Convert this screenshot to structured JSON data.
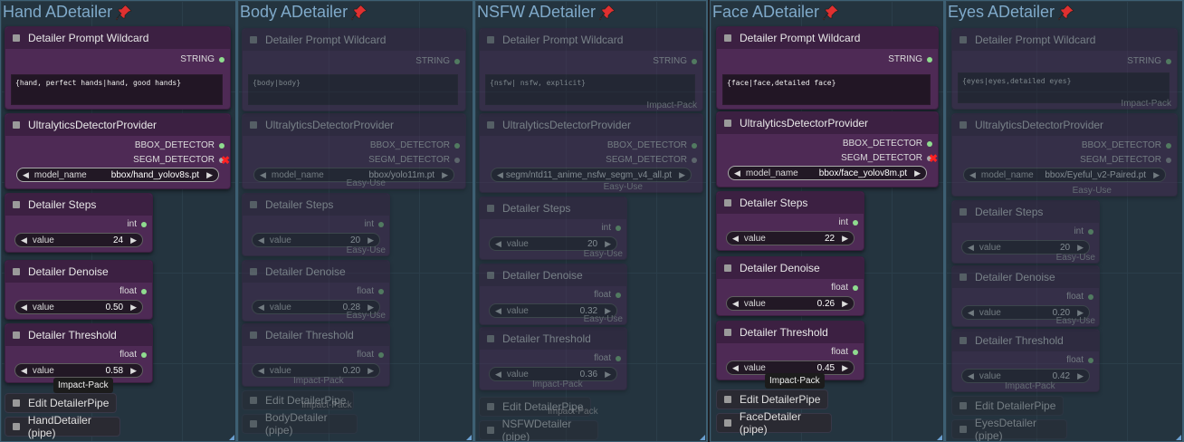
{
  "groups": [
    {
      "title": "Hand ADetailer",
      "active": true,
      "wildcard": {
        "title": "Detailer Prompt Wildcard",
        "output": "STRING",
        "text": "{hand, perfect hands|hand, good hands}"
      },
      "provider": {
        "title": "UltralyticsDetectorProvider",
        "out1": "BBOX_DETECTOR",
        "out2": "SEGM_DETECTOR",
        "model_label": "model_name",
        "model_value": "bbox/hand_yolov8s.pt"
      },
      "steps": {
        "title": "Detailer Steps",
        "type": "int",
        "label": "value",
        "value": "24"
      },
      "denoise": {
        "title": "Detailer Denoise",
        "type": "float",
        "label": "value",
        "value": "0.50"
      },
      "threshold": {
        "title": "Detailer Threshold",
        "type": "float",
        "label": "value",
        "value": "0.58"
      },
      "tooltip": "Impact-Pack",
      "edit_pipe": "Edit DetailerPipe",
      "pipe": "HandDetailer (pipe)"
    },
    {
      "title": "Body ADetailer",
      "active": false,
      "wildcard": {
        "title": "Detailer Prompt Wildcard",
        "output": "STRING",
        "text": "{body|body}"
      },
      "provider": {
        "title": "UltralyticsDetectorProvider",
        "out1": "BBOX_DETECTOR",
        "out2": "SEGM_DETECTOR",
        "model_label": "model_name",
        "model_value": "bbox/yolo11m.pt",
        "badge": "Easy-Use"
      },
      "steps": {
        "title": "Detailer Steps",
        "type": "int",
        "label": "value",
        "value": "20",
        "badge": "Easy-Use"
      },
      "denoise": {
        "title": "Detailer Denoise",
        "type": "float",
        "label": "value",
        "value": "0.28",
        "badge": "Easy-Use"
      },
      "threshold": {
        "title": "Detailer Threshold",
        "type": "float",
        "label": "value",
        "value": "0.20",
        "badge": "Impact-Pack"
      },
      "edit_pipe": "Edit DetailerPipe",
      "edit_badge": "Impact-Pack",
      "pipe": "BodyDetailer (pipe)"
    },
    {
      "title": "NSFW ADetailer",
      "active": false,
      "wildcard": {
        "title": "Detailer Prompt Wildcard",
        "output": "STRING",
        "text": "{nsfw| nsfw, explicit}",
        "badge": "Impact-Pack"
      },
      "provider": {
        "title": "UltralyticsDetectorProvider",
        "out1": "BBOX_DETECTOR",
        "out2": "SEGM_DETECTOR",
        "model_value": "segm/ntd11_anime_nsfw_segm_v4_all.pt",
        "badge": "Easy-Use"
      },
      "steps": {
        "title": "Detailer Steps",
        "type": "int",
        "label": "value",
        "value": "20",
        "badge": "Easy-Use"
      },
      "denoise": {
        "title": "Detailer Denoise",
        "type": "float",
        "label": "value",
        "value": "0.32",
        "badge": "Easy-Use"
      },
      "threshold": {
        "title": "Detailer Threshold",
        "type": "float",
        "label": "value",
        "value": "0.36",
        "badge": "Impact-Pack"
      },
      "edit_pipe": "Edit DetailerPipe",
      "edit_badge": "Impact-Pack",
      "pipe": "NSFWDetailer (pipe)"
    },
    {
      "title": "Face ADetailer",
      "active": true,
      "wildcard": {
        "title": "Detailer Prompt Wildcard",
        "output": "STRING",
        "text": "{face|face,detailed face}"
      },
      "provider": {
        "title": "UltralyticsDetectorProvider",
        "out1": "BBOX_DETECTOR",
        "out2": "SEGM_DETECTOR",
        "model_label": "model_name",
        "model_value": "bbox/face_yolov8m.pt"
      },
      "steps": {
        "title": "Detailer Steps",
        "type": "int",
        "label": "value",
        "value": "22"
      },
      "denoise": {
        "title": "Detailer Denoise",
        "type": "float",
        "label": "value",
        "value": "0.26"
      },
      "threshold": {
        "title": "Detailer Threshold",
        "type": "float",
        "label": "value",
        "value": "0.45"
      },
      "tooltip": "Impact-Pack",
      "edit_pipe": "Edit DetailerPipe",
      "pipe": "FaceDetailer (pipe)"
    },
    {
      "title": "Eyes ADetailer",
      "active": false,
      "wildcard": {
        "title": "Detailer Prompt Wildcard",
        "output": "STRING",
        "text": "{eyes|eyes,detailed eyes}",
        "badge": "Impact-Pack"
      },
      "provider": {
        "title": "UltralyticsDetectorProvider",
        "out1": "BBOX_DETECTOR",
        "out2": "SEGM_DETECTOR",
        "model_label": "model_name",
        "model_value": "bbox/Eyeful_v2-Paired.pt",
        "badge": "Easy-Use"
      },
      "steps": {
        "title": "Detailer Steps",
        "type": "int",
        "label": "value",
        "value": "20",
        "badge": "Easy-Use"
      },
      "denoise": {
        "title": "Detailer Denoise",
        "type": "float",
        "label": "value",
        "value": "0.20",
        "badge": "Easy-Use"
      },
      "threshold": {
        "title": "Detailer Threshold",
        "type": "float",
        "label": "value",
        "value": "0.42",
        "badge": "Impact-Pack"
      },
      "edit_pipe": "Edit DetailerPipe",
      "pipe": "EyesDetailer (pipe)"
    }
  ]
}
